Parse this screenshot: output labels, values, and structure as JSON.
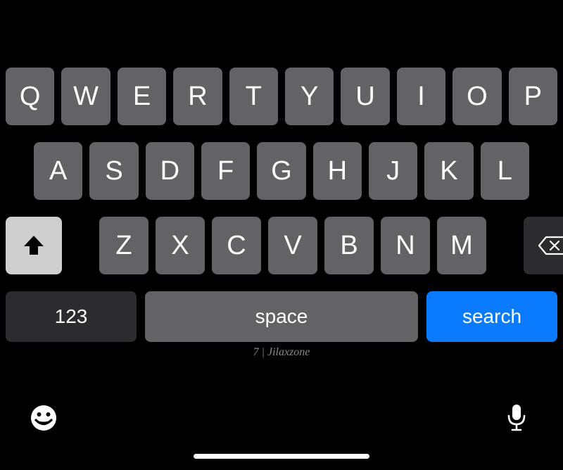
{
  "keyboard": {
    "row1": [
      "Q",
      "W",
      "E",
      "R",
      "T",
      "Y",
      "U",
      "I",
      "O",
      "P"
    ],
    "row2": [
      "A",
      "S",
      "D",
      "F",
      "G",
      "H",
      "J",
      "K",
      "L"
    ],
    "row3": [
      "Z",
      "X",
      "C",
      "V",
      "B",
      "N",
      "M"
    ],
    "numeric_label": "123",
    "space_label": "space",
    "action_label": "search",
    "action_color": "#0a7bff"
  },
  "caption": "7 | Jilaxzone",
  "icons": {
    "shift": "shift-icon",
    "delete": "delete-icon",
    "emoji": "emoji-icon",
    "mic": "mic-icon"
  }
}
